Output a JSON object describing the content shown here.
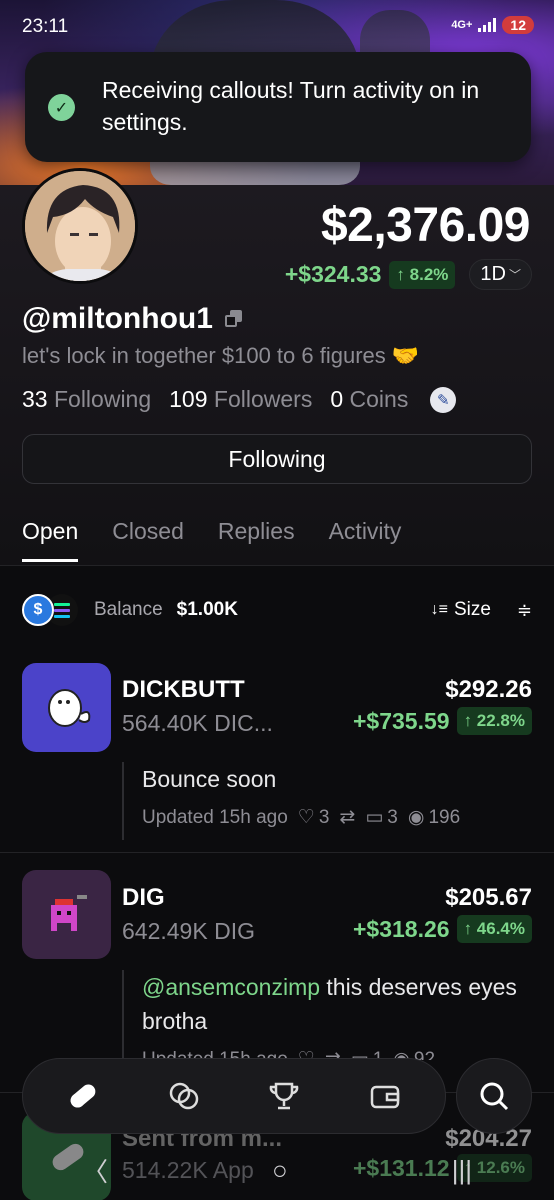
{
  "status_bar": {
    "time": "23:11",
    "network": "4G+",
    "battery": "12"
  },
  "toast": {
    "message": "Receiving callouts! Turn activity on in settings."
  },
  "profile": {
    "balance": "$2,376.09",
    "pnl_abs": "+$324.33",
    "pnl_pct": "↑ 8.2%",
    "range": "1D",
    "handle": "@miltonhou1",
    "bio": "let's lock in together $100 to 6 figures 🤝",
    "following_count": "33",
    "following_label": "Following",
    "followers_count": "109",
    "followers_label": "Followers",
    "coins_count": "0",
    "coins_label": "Coins",
    "follow_button": "Following"
  },
  "tabs": [
    "Open",
    "Closed",
    "Replies",
    "Activity"
  ],
  "balance_row": {
    "label": "Balance",
    "value": "$1.00K",
    "sort_label": "Size"
  },
  "positions": [
    {
      "name": "DICKBUTT",
      "qty": "564.40K DIC...",
      "value": "$292.26",
      "pnl_abs": "+$735.59",
      "pnl_pct": "↑ 22.8%",
      "callout": "Bounce soon",
      "updated": "Updated 15h ago",
      "likes": "3",
      "reposts": "",
      "replies": "3",
      "views": "196"
    },
    {
      "name": "DIG",
      "qty": "642.49K DIG",
      "value": "$205.67",
      "pnl_abs": "+$318.26",
      "pnl_pct": "↑ 46.4%",
      "mention": "@ansemconzimp",
      "callout": " this deserves eyes brotha",
      "updated": "Updated 15h ago",
      "likes": "",
      "reposts": "",
      "replies": "1",
      "views": "92"
    },
    {
      "name": "Sent from m...",
      "qty": "514.22K App",
      "value": "$204.27",
      "pnl_abs": "+$131.12",
      "pnl_pct": "↑ 12.6%"
    }
  ],
  "colors": {
    "positive": "#7ed68b",
    "positive_bg": "#163a1f",
    "background": "#0c0c0e"
  }
}
